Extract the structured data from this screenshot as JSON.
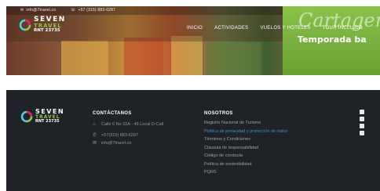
{
  "topbar": {
    "email": "info@7travel.co",
    "phone": "+57 (315) 883-6287"
  },
  "logo": {
    "word1": "SEVEN",
    "word2": "TRAVEL",
    "rnt": "RNT 23735"
  },
  "nav": {
    "items": [
      "INICIO",
      "ACTIVIDADES",
      "VUELOS Y HOTELES",
      "TOUR INCLUIDO"
    ]
  },
  "hero": {
    "banner_script": "Cartagena",
    "banner_title": "Temporada ba"
  },
  "footer": {
    "contact_title": "CONTÁCTANOS",
    "address": "Calle 6 No 32A - 45 Local D-Call",
    "phone": "+57(315) 883-6287",
    "email": "info@7travel.co",
    "about_title": "NOSOTROS",
    "links": [
      "Registro Nacional de Turismo",
      "Política de privacidad y protección de datos",
      "Términos y Condiciones",
      "Cláusula de responsabilidad",
      "Código de conducta",
      "Política de sostenibilidad",
      "PQRS"
    ],
    "active_link_index": 1
  },
  "colors": {
    "footer_bg": "#1f2327",
    "accent_green": "#8bc34a",
    "link_active": "#2f8fd8"
  }
}
